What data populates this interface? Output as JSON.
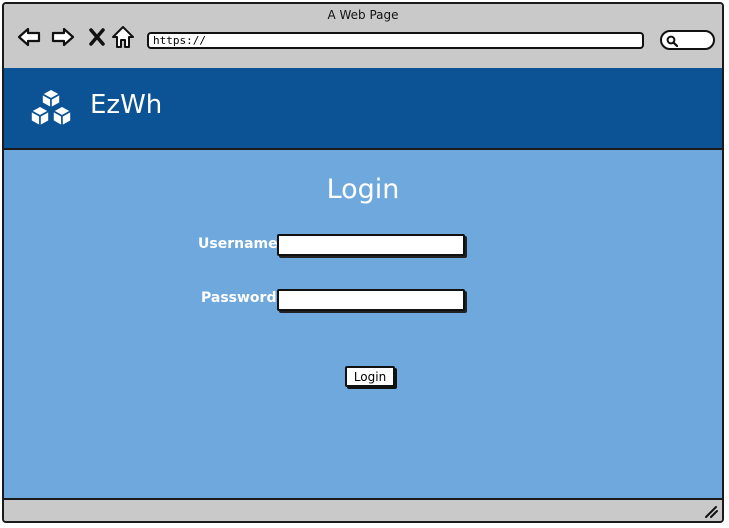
{
  "window": {
    "title": "A Web Page"
  },
  "toolbar": {
    "icons": [
      "back-icon",
      "forward-icon",
      "close-icon",
      "home-icon"
    ],
    "address": "https://",
    "search_icon": "search-icon"
  },
  "header": {
    "brand": "EzWh",
    "logo_icon": "cubes-icon",
    "background": "#0b5394"
  },
  "main": {
    "title": "Login",
    "background": "#6fa8dc",
    "username_label": "Username",
    "username_value": "",
    "password_label": "Password",
    "password_value": "",
    "login_button": "Login"
  }
}
